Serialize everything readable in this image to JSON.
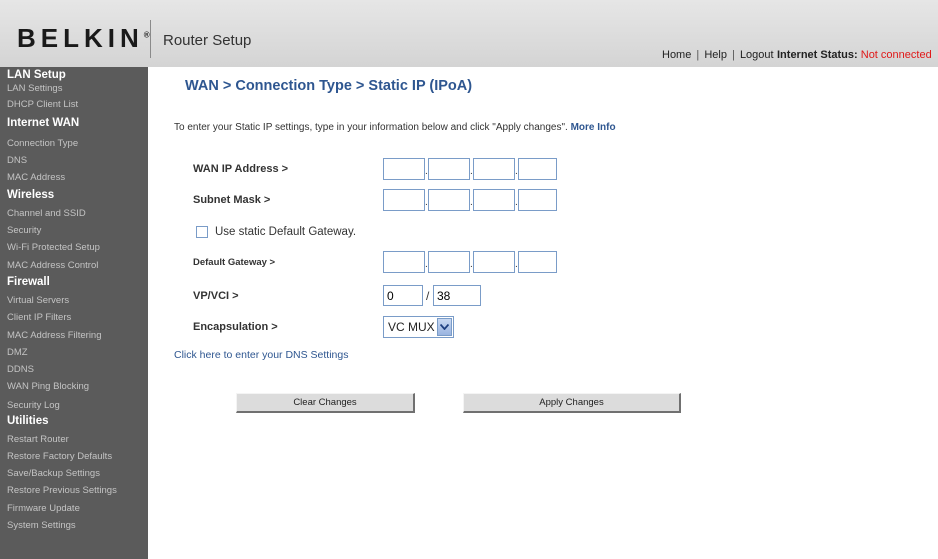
{
  "header": {
    "logo": "BELKIN",
    "logo_mark": "®",
    "app_title": "Router Setup",
    "links": [
      "Home",
      "Help",
      "Logout"
    ],
    "link_separator": "|",
    "status_label": "Internet Status:",
    "status_value": "Not connected"
  },
  "sidebar": {
    "groups": [
      {
        "title": "LAN Setup",
        "items": [
          "LAN Settings",
          "DHCP Client List"
        ]
      },
      {
        "title": "Internet WAN",
        "items": [
          "Connection Type",
          "DNS",
          "MAC Address"
        ]
      },
      {
        "title": "Wireless",
        "items": [
          "Channel and SSID",
          "Security",
          "Wi-Fi Protected Setup",
          "MAC Address Control"
        ]
      },
      {
        "title": "Firewall",
        "items": [
          "Virtual Servers",
          "Client IP Filters",
          "MAC Address Filtering",
          "DMZ",
          "DDNS",
          "WAN Ping Blocking",
          "Security Log"
        ]
      },
      {
        "title": "Utilities",
        "items": [
          "Restart Router",
          "Restore Factory Defaults",
          "Save/Backup Settings",
          "Restore Previous Settings",
          "Firmware Update",
          "System Settings"
        ]
      }
    ]
  },
  "main": {
    "breadcrumb": "WAN > Connection Type > Static IP (IPoA)",
    "intro": "To enter your Static IP settings, type in your information below and click \"Apply changes\".",
    "more_info": "More Info",
    "wan_ip_label": "WAN IP Address >",
    "subnet_label": "Subnet Mask >",
    "gateway_checkbox_label": "Use static Default Gateway.",
    "gateway_checked": false,
    "gateway_label": "Default Gateway >",
    "octet_separator": ".",
    "wan_ip": [
      "",
      "",
      "",
      ""
    ],
    "subnet": [
      "",
      "",
      "",
      ""
    ],
    "gateway": [
      "",
      "",
      "",
      ""
    ],
    "vpvci_label": "VP/VCI >",
    "vp_value": "0",
    "vpvci_separator": "/",
    "vci_value": "38",
    "encap_label": "Encapsulation >",
    "encap_value": "VC MUX",
    "dns_link": "Click here to enter your DNS Settings",
    "clear_button": "Clear Changes",
    "apply_button": "Apply Changes"
  },
  "colors": {
    "accent_blue": "#2e5690",
    "status_red": "#e01818",
    "sidebar_bg": "#5b5b5b"
  }
}
